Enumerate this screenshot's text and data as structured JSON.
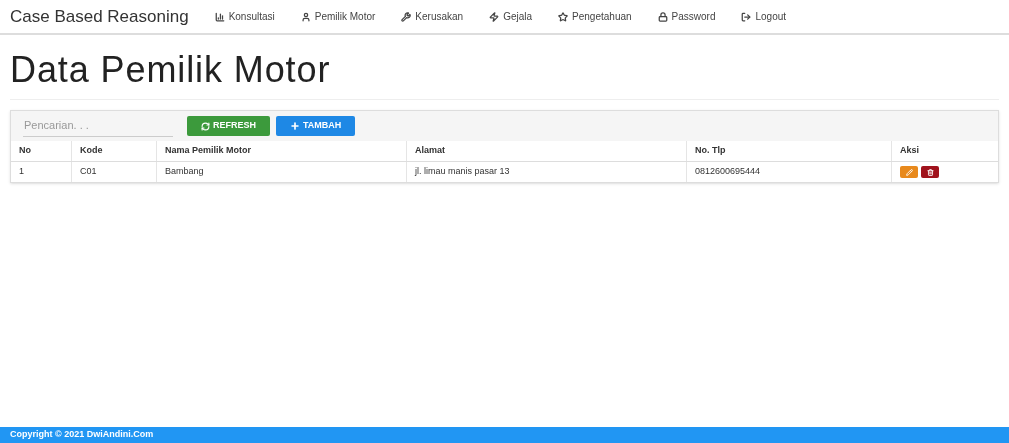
{
  "brand": "Case Based Reasoning",
  "nav": [
    {
      "label": "Konsultasi"
    },
    {
      "label": "Pemilik Motor"
    },
    {
      "label": "Kerusakan"
    },
    {
      "label": "Gejala"
    },
    {
      "label": "Pengetahuan"
    },
    {
      "label": "Password"
    },
    {
      "label": "Logout"
    }
  ],
  "title": "Data Pemilik Motor",
  "search": {
    "placeholder": "Pencarian. . ."
  },
  "buttons": [
    {
      "label": "REFRESH",
      "kind": "refresh"
    },
    {
      "label": "TAMBAH",
      "kind": "add"
    }
  ],
  "table": {
    "columns": [
      "No",
      "Kode",
      "Nama Pemilik Motor",
      "Alamat",
      "No. Tlp",
      "Aksi"
    ],
    "rows": [
      {
        "cells": [
          "1",
          "C01",
          "Bambang",
          "jl. limau manis pasar 13",
          "0812600695444"
        ]
      }
    ]
  },
  "footer": "Copyright © 2021 DwiAndini.Com"
}
